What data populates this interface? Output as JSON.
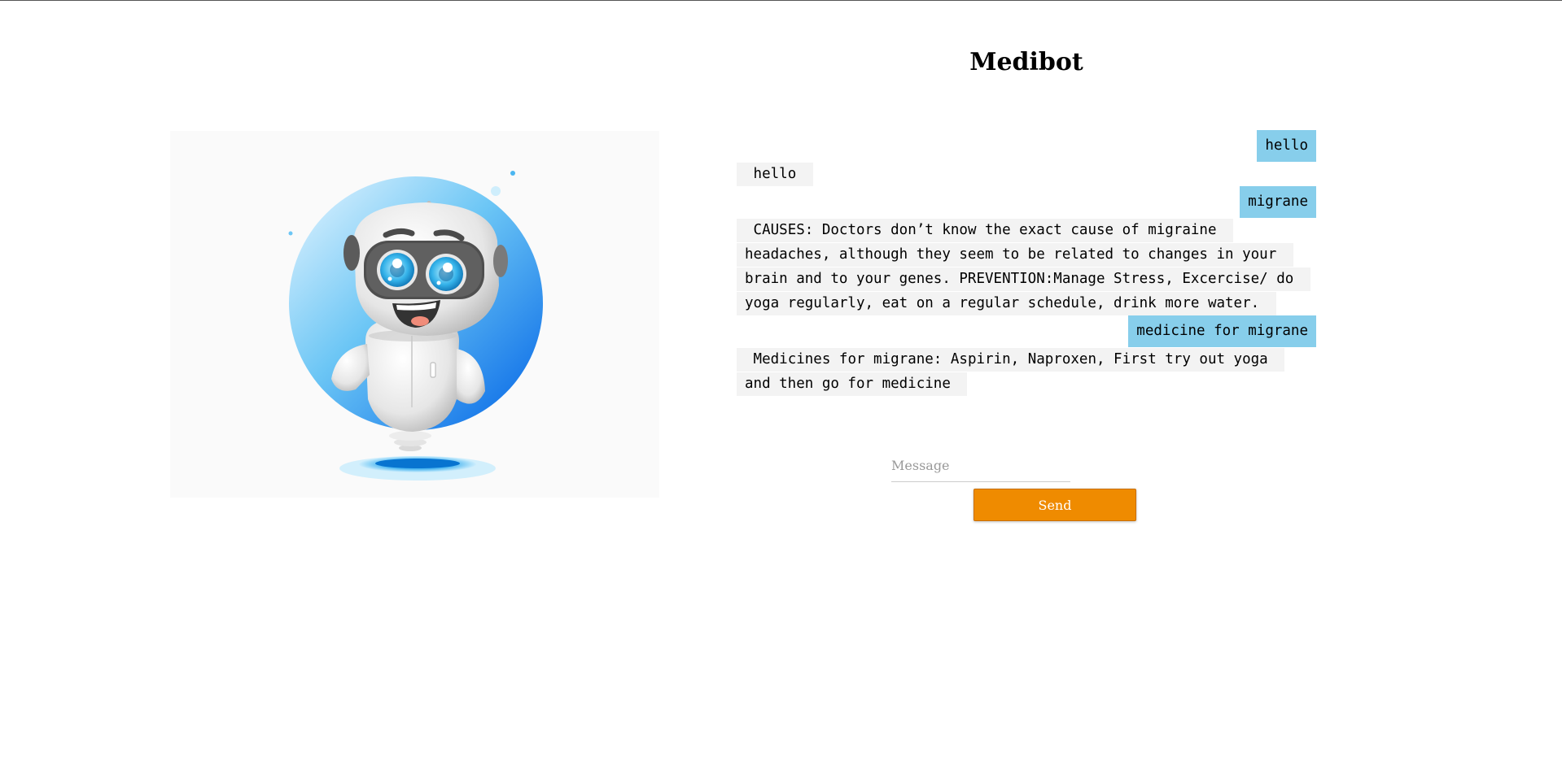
{
  "app": {
    "title": "Medibot"
  },
  "colors": {
    "user_bubble": "#87ceeb",
    "bot_bubble": "#f3f3f3",
    "send_button": "#ef8b00"
  },
  "hero": {
    "image": "robot-mascot-illustration"
  },
  "chat": {
    "messages": [
      {
        "role": "user",
        "text": "hello"
      },
      {
        "role": "bot",
        "text": " hello "
      },
      {
        "role": "user",
        "text": "migrane"
      },
      {
        "role": "bot",
        "text": " CAUSES: Doctors don’t know the exact cause of migraine headaches, although they seem to be related to changes in your brain and to your genes. PREVENTION:Manage Stress, Excercise/ do yoga regularly, eat on a regular schedule, drink more water. "
      },
      {
        "role": "user",
        "text": "medicine for migrane"
      },
      {
        "role": "bot",
        "text": " Medicines for migrane: Aspirin, Naproxen, First try out yoga and then go for medicine "
      }
    ]
  },
  "composer": {
    "placeholder": "Message",
    "value": "",
    "send_label": "Send"
  }
}
